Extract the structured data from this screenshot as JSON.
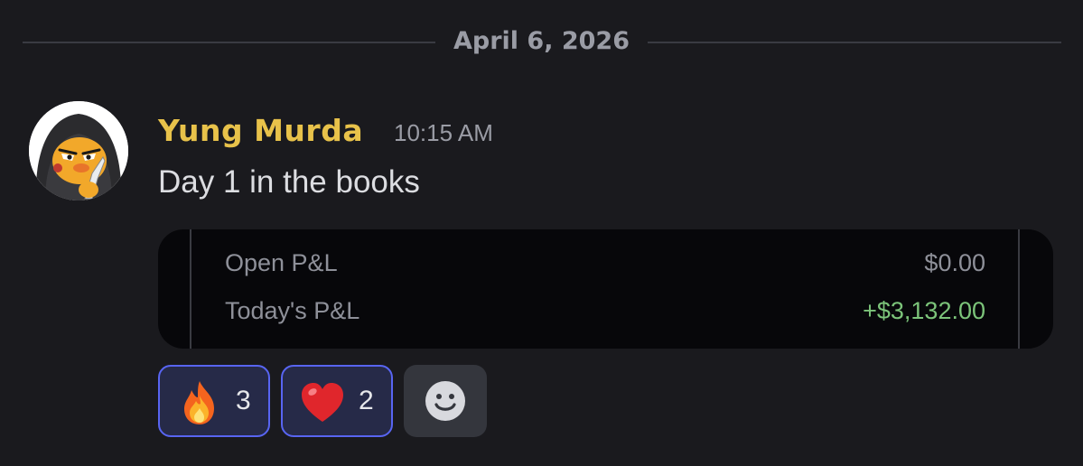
{
  "divider": {
    "date": "April 6, 2026"
  },
  "message": {
    "author": "Yung Murda",
    "timestamp": "10:15 AM",
    "text": "Day 1 in the books",
    "author_color": "#e8c24a"
  },
  "pnl_card": {
    "rows": [
      {
        "label": "Open P&L",
        "value": "$0.00"
      },
      {
        "label": "Today's P&L",
        "value": "+$3,132.00",
        "value_color": "#7cc47a"
      }
    ]
  },
  "reactions": [
    {
      "icon": "fire-icon",
      "count": "3",
      "selected": true
    },
    {
      "icon": "heart-icon",
      "count": "2",
      "selected": true
    }
  ],
  "add_reaction": {
    "icon": "smiley-icon"
  }
}
